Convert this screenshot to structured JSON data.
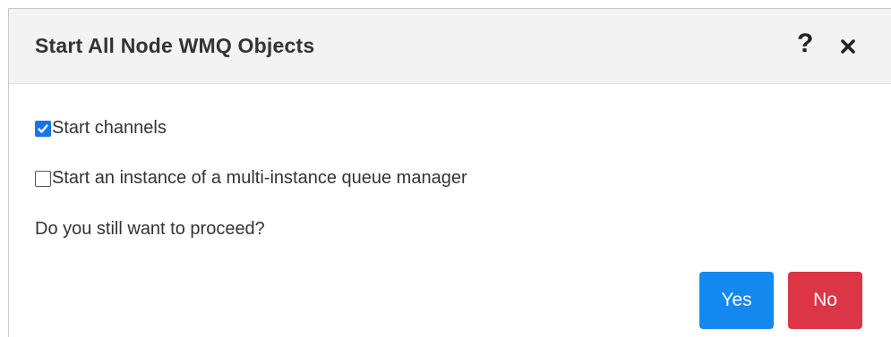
{
  "dialog": {
    "title": "Start All Node WMQ Objects",
    "help_icon": "?",
    "close_icon": "close-icon"
  },
  "options": [
    {
      "label": "Start channels",
      "checked": true
    },
    {
      "label": "Start an instance of a multi-instance queue manager",
      "checked": false
    }
  ],
  "question": "Do you still want to proceed?",
  "buttons": {
    "yes_label": "Yes",
    "no_label": "No",
    "yes_color": "#1389f0",
    "no_color": "#dc3545"
  }
}
